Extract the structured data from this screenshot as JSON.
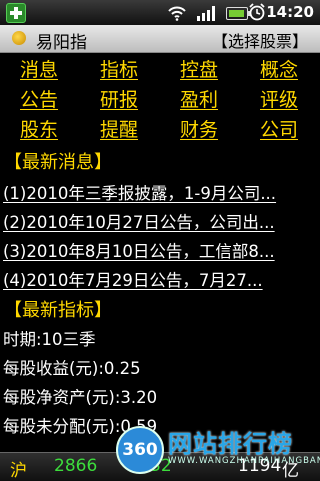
{
  "status_bar": {
    "time": "14:20",
    "icons": [
      "app-notification-icon",
      "wifi-icon",
      "signal-icon",
      "battery-icon",
      "alarm-icon"
    ]
  },
  "title_bar": {
    "title": "易阳指",
    "select_stock": "【选择股票】"
  },
  "menu": [
    [
      "消息",
      "指标",
      "控盘",
      "概念"
    ],
    [
      "公告",
      "研报",
      "盈利",
      "评级"
    ],
    [
      "股东",
      "提醒",
      "财务",
      "公司"
    ]
  ],
  "news": {
    "heading": "【最新消息】",
    "items": [
      "(1)2010年三季报披露，1-9月公司...",
      "(2)2010年10月27日公告，公司出...",
      "(3)2010年8月10日公告，工信部8...",
      "(4)2010年7月29日公告，7月27..."
    ]
  },
  "indicators": {
    "heading": "【最新指标】",
    "items": [
      "时期:10三季",
      "每股收益(元):0.25",
      "每股净资产(元):3.20",
      "每股未分配(元):0.59"
    ]
  },
  "ticker": {
    "market": "沪",
    "index": "2866",
    "change": "32",
    "volume": "1194",
    "unit": "亿"
  },
  "watermark": {
    "badge": "360",
    "text": "网站排行榜",
    "sub": "WWW.WANGZHANPAIHANGBANG"
  },
  "colors": {
    "menu_text": "#ffd800",
    "up_green": "#3cdc3c",
    "background": "#000000"
  }
}
